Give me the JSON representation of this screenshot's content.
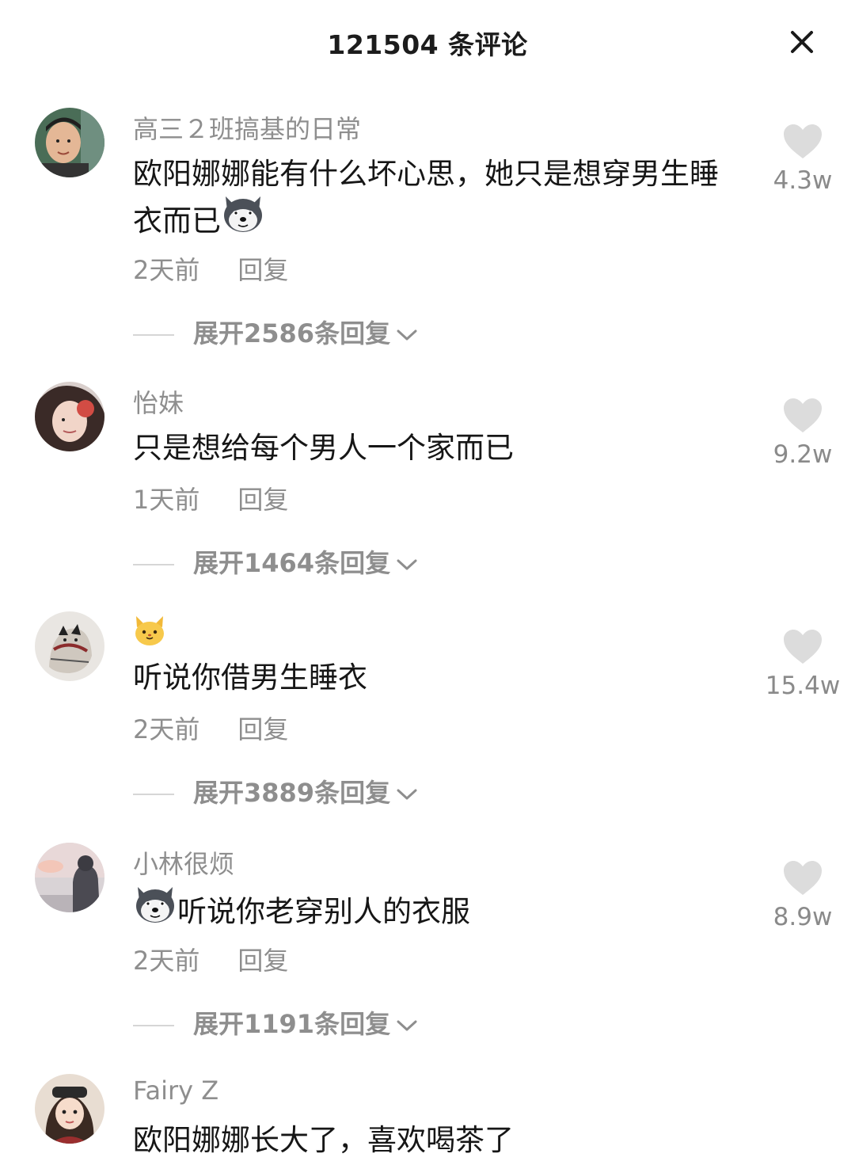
{
  "header": {
    "title": "121504 条评论",
    "close_icon": "close-icon"
  },
  "comments": [
    {
      "username": "高三２班搞基的日常",
      "text": "欧阳娜娜能有什么坏心思，她只是想穿男生睡衣而已",
      "emoji": "husky-emoji",
      "time": "2天前",
      "reply": "回复",
      "expand": "展开2586条回复",
      "likes": "4.3w"
    },
    {
      "username": "怡妹",
      "text": "只是想给每个男人一个家而已",
      "time": "1天前",
      "reply": "回复",
      "expand": "展开1464条回复",
      "likes": "9.2w"
    },
    {
      "username": "🐱",
      "text": "听说你借男生睡衣",
      "time": "2天前",
      "reply": "回复",
      "expand": "展开3889条回复",
      "likes": "15.4w"
    },
    {
      "username": "小林很烦",
      "text": "听说你老穿别人的衣服",
      "emoji": "husky-emoji",
      "time": "2天前",
      "reply": "回复",
      "expand": "展开1191条回复",
      "likes": "8.9w"
    },
    {
      "username": "Fairy  Z",
      "text": "欧阳娜娜长大了，喜欢喝茶了"
    }
  ],
  "colors": {
    "text": "#161616",
    "muted": "#8e8e8e",
    "heart": "#dcdcdc"
  }
}
